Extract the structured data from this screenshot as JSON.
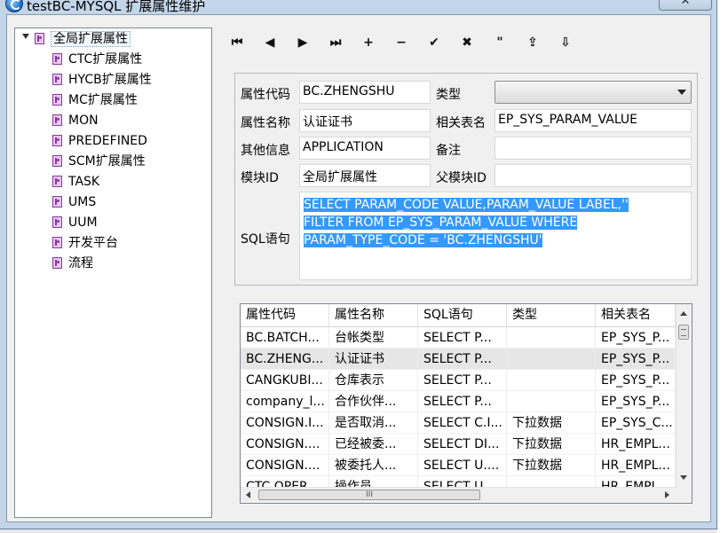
{
  "window": {
    "title": "testBC-MYSQL 扩展属性维护",
    "close_label": "✕"
  },
  "tree": {
    "root": "全局扩展属性",
    "items": [
      "CTC扩展属性",
      "HYCB扩展属性",
      "MC扩展属性",
      "MON",
      "PREDEFINED",
      "SCM扩展属性",
      "TASK",
      "UMS",
      "UUM",
      "开发平台",
      "流程"
    ]
  },
  "toolbar": {
    "buttons": [
      {
        "name": "first-record-button",
        "glyph": "⏮"
      },
      {
        "name": "prev-record-button",
        "glyph": "◀"
      },
      {
        "name": "next-record-button",
        "glyph": "▶"
      },
      {
        "name": "last-record-button",
        "glyph": "⏭"
      },
      {
        "name": "add-button",
        "glyph": "+"
      },
      {
        "name": "delete-button",
        "glyph": "−"
      },
      {
        "name": "save-button",
        "glyph": "✔"
      },
      {
        "name": "cancel-button",
        "glyph": "✖"
      },
      {
        "name": "quote-button",
        "glyph": "\""
      },
      {
        "name": "export-button",
        "glyph": "⇪"
      },
      {
        "name": "import-button",
        "glyph": "⇩"
      }
    ]
  },
  "form": {
    "code_label": "属性代码",
    "code_value": "BC.ZHENGSHU",
    "type_label": "类型",
    "type_value": "",
    "name_label": "属性名称",
    "name_value": "认证证书",
    "table_label": "相关表名",
    "table_value": "EP_SYS_PARAM_VALUE",
    "other_label": "其他信息",
    "other_value": "APPLICATION",
    "remark_label": "备注",
    "remark_value": "",
    "module_label": "模块ID",
    "module_value": "全局扩展属性",
    "parent_label": "父模块ID",
    "parent_value": "",
    "sql_label": "SQL语句",
    "sql_lines": [
      "SELECT PARAM_CODE VALUE,PARAM_VALUE LABEL,''",
      "FILTER FROM EP_SYS_PARAM_VALUE WHERE",
      "PARAM_TYPE_CODE = 'BC.ZHENGSHU'"
    ]
  },
  "grid": {
    "columns": [
      "属性代码",
      "属性名称",
      "SQL语句",
      "类型",
      "相关表名"
    ],
    "rows": [
      [
        "BC.BATCH...",
        "台帐类型",
        "SELECT P...",
        "",
        "EP_SYS_P..."
      ],
      [
        "BC.ZHENG...",
        "认证证书",
        "SELECT P...",
        "",
        "EP_SYS_P..."
      ],
      [
        "CANGKUBI...",
        "仓库表示",
        "SELECT P...",
        "",
        "EP_SYS_P..."
      ],
      [
        "company_l...",
        "合作伙伴...",
        "SELECT P...",
        "",
        "EP_SYS_P..."
      ],
      [
        "CONSIGN.I...",
        "是否取消...",
        "SELECT C.I...",
        "下拉数据",
        "EP_SYS_C..."
      ],
      [
        "CONSIGN....",
        "已经被委...",
        "SELECT DI...",
        "下拉数据",
        "HR_EMPL..."
      ],
      [
        "CONSIGN....",
        "被委托人...",
        "SELECT U....",
        "下拉数据",
        "HR_EMPL..."
      ],
      [
        "CTC.OPER...",
        "操作员",
        "SELECT U...",
        "",
        "HR_EMPL..."
      ]
    ],
    "selected_row": 1,
    "hscroll_grip": "III"
  }
}
